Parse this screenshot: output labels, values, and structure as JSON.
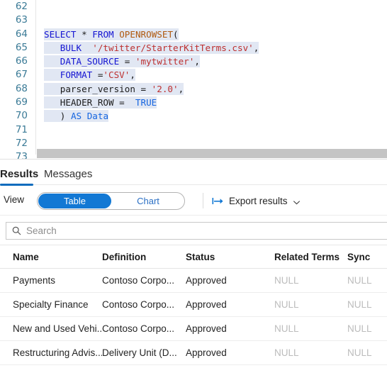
{
  "editor": {
    "line_numbers": [
      "62",
      "63",
      "64",
      "65",
      "66",
      "67",
      "68",
      "69",
      "70",
      "71",
      "72",
      "73"
    ],
    "code_lines": [
      {
        "n": "62",
        "tokens": []
      },
      {
        "n": "63",
        "tokens": []
      },
      {
        "n": "64",
        "tokens": [
          {
            "t": "SELECT",
            "c": "kw"
          },
          {
            "t": " ",
            "c": "plain"
          },
          {
            "t": "*",
            "c": "plain"
          },
          {
            "t": " ",
            "c": "plain"
          },
          {
            "t": "FROM",
            "c": "kw"
          },
          {
            "t": " ",
            "c": "plain"
          },
          {
            "t": "OPENROWSET",
            "c": "fn"
          },
          {
            "t": "(",
            "c": "plain"
          }
        ]
      },
      {
        "n": "65",
        "tokens": [
          {
            "t": "   ",
            "c": "plain"
          },
          {
            "t": "BULK",
            "c": "kw"
          },
          {
            "t": "  ",
            "c": "plain"
          },
          {
            "t": "'/twitter/StarterKitTerms.csv'",
            "c": "str"
          },
          {
            "t": ",",
            "c": "plain"
          }
        ]
      },
      {
        "n": "66",
        "tokens": [
          {
            "t": "   ",
            "c": "plain"
          },
          {
            "t": "DATA_SOURCE",
            "c": "kw"
          },
          {
            "t": " = ",
            "c": "plain"
          },
          {
            "t": "'mytwitter'",
            "c": "str"
          },
          {
            "t": ",",
            "c": "plain"
          }
        ]
      },
      {
        "n": "67",
        "tokens": [
          {
            "t": "   ",
            "c": "plain"
          },
          {
            "t": "FORMAT",
            "c": "kw"
          },
          {
            "t": " =",
            "c": "plain"
          },
          {
            "t": "'CSV'",
            "c": "str"
          },
          {
            "t": ",",
            "c": "plain"
          }
        ]
      },
      {
        "n": "68",
        "tokens": [
          {
            "t": "   ",
            "c": "plain"
          },
          {
            "t": "parser_version",
            "c": "plain"
          },
          {
            "t": " = ",
            "c": "plain"
          },
          {
            "t": "'2.0'",
            "c": "str"
          },
          {
            "t": ",",
            "c": "plain"
          }
        ]
      },
      {
        "n": "69",
        "tokens": [
          {
            "t": "   ",
            "c": "plain"
          },
          {
            "t": "HEADER_ROW",
            "c": "plain"
          },
          {
            "t": " =  ",
            "c": "plain"
          },
          {
            "t": "TRUE",
            "c": "kw2"
          }
        ]
      },
      {
        "n": "70",
        "tokens": [
          {
            "t": "   ",
            "c": "plain"
          },
          {
            "t": ")",
            "c": "plain"
          },
          {
            "t": " ",
            "c": "plain"
          },
          {
            "t": "AS",
            "c": "kw2"
          },
          {
            "t": " ",
            "c": "plain"
          },
          {
            "t": "Data",
            "c": "kw2"
          }
        ]
      },
      {
        "n": "71",
        "tokens": []
      },
      {
        "n": "72",
        "tokens": []
      },
      {
        "n": "73",
        "tokens": []
      }
    ]
  },
  "tabs": {
    "results_label": "Results",
    "messages_label": "Messages",
    "active": "Results"
  },
  "toolbar": {
    "view_label": "View",
    "toggle": {
      "table_label": "Table",
      "chart_label": "Chart",
      "selected": "Table"
    },
    "export_label": "Export results",
    "export_icon": "export-arrow-icon",
    "chevron_icon": "chevron-down-icon"
  },
  "search": {
    "placeholder": "Search",
    "value": "",
    "icon": "search-icon"
  },
  "table": {
    "columns": [
      "Name",
      "Definition",
      "Status",
      "Related Terms",
      "Sync"
    ],
    "rows": [
      {
        "name": "Payments",
        "definition": "Contoso Corpo...",
        "status": "Approved",
        "related": "NULL",
        "sync": "NULL"
      },
      {
        "name": "Specialty Finance",
        "definition": "Contoso Corpo...",
        "status": "Approved",
        "related": "NULL",
        "sync": "NULL"
      },
      {
        "name": "New and Used Vehi...",
        "definition": "Contoso Corpo...",
        "status": "Approved",
        "related": "NULL",
        "sync": "NULL"
      },
      {
        "name": "Restructuring Advis...",
        "definition": "Delivery Unit (D...",
        "status": "Approved",
        "related": "NULL",
        "sync": "NULL"
      }
    ]
  },
  "colors": {
    "accent_blue": "#1278d4",
    "tab_underline": "#0f6cbd",
    "keyword": "#1414d2",
    "function": "#b05a10",
    "string": "#bd3030",
    "identifier": "#1565e0",
    "line_number": "#3a7a96",
    "code_highlight": "#e1e7f3",
    "null_text": "#bcbcbc",
    "scrollbar": "#c4c4c4"
  }
}
